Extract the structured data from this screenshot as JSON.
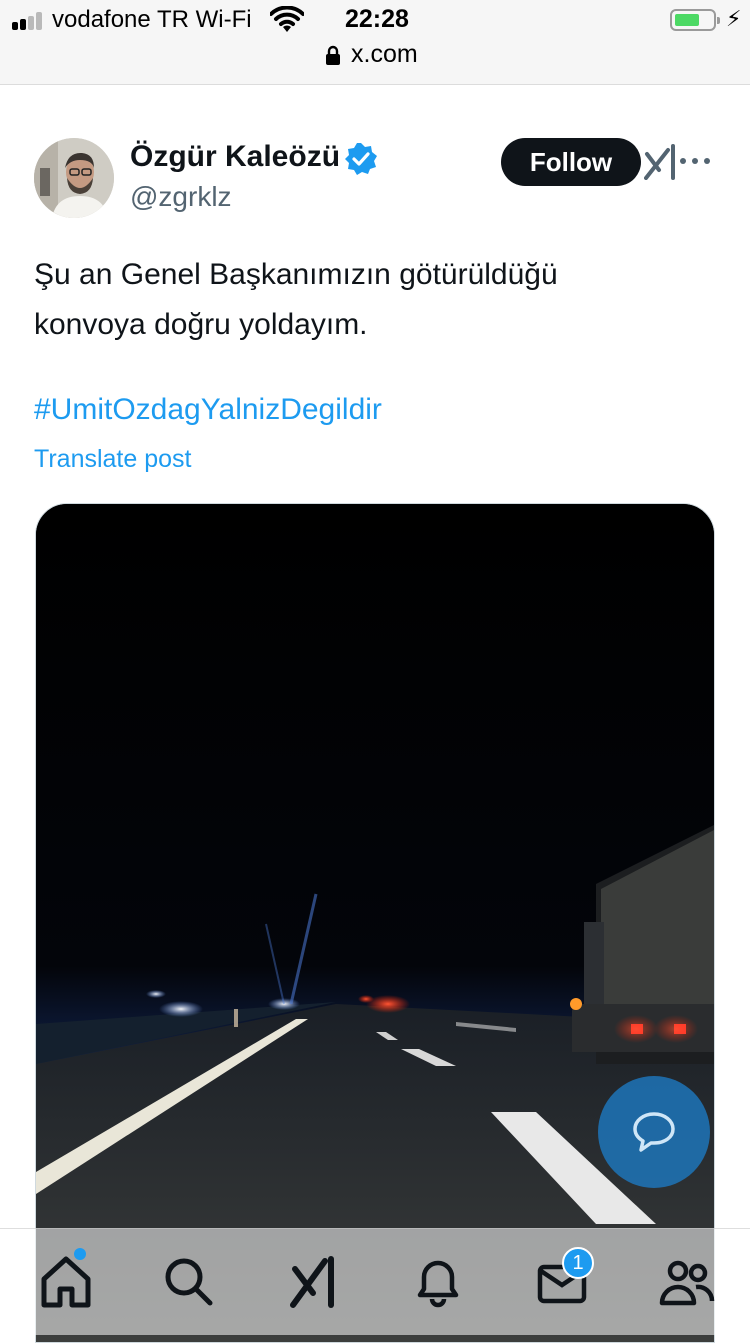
{
  "status_bar": {
    "carrier": "vodafone TR Wi-Fi",
    "time": "22:28",
    "url": "x.com",
    "battery_level": 0.6,
    "signal_bars_active": 2,
    "icons": [
      "signal-icon",
      "wifi-icon",
      "battery-icon",
      "charging-icon",
      "lock-icon"
    ]
  },
  "post": {
    "author_name": "Özgür Kaleözü",
    "author_handle": "@zgrklz",
    "follow_label": "Follow",
    "text_line1": "Şu an Genel Başkanımızın götürüldüğü",
    "text_line2": "konvoya doğru yoldayım.",
    "hashtag": "#UmitOzdagYalnizDegildir",
    "translate_label": "Translate post",
    "icons": [
      "verified-icon",
      "grok-icon",
      "more-icon"
    ]
  },
  "media": {
    "description_icon": "night-highway-photo"
  },
  "fab": {
    "icon": "reply-bubble-icon"
  },
  "bottom_nav": {
    "items": [
      {
        "name": "home",
        "icon": "home-icon"
      },
      {
        "name": "search",
        "icon": "search-icon"
      },
      {
        "name": "grok",
        "icon": "grok-icon"
      },
      {
        "name": "notifications",
        "icon": "bell-icon"
      },
      {
        "name": "messages",
        "icon": "mail-icon"
      },
      {
        "name": "communities",
        "icon": "people-icon"
      }
    ],
    "messages_badge": "1"
  },
  "colors": {
    "accent": "#1d9bf0",
    "text": "#0f1419",
    "secondary": "#536471"
  }
}
